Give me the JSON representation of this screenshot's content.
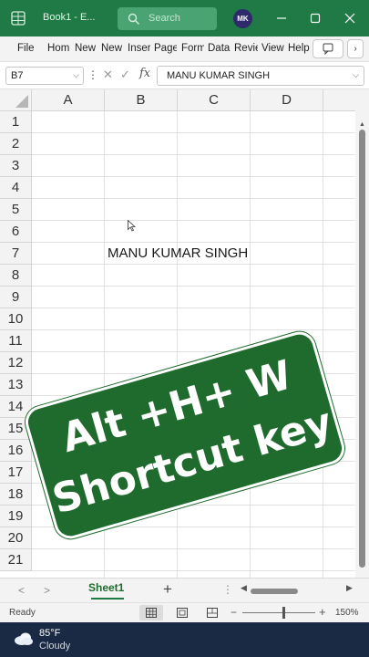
{
  "titlebar": {
    "doc_title": "Book1 - E...",
    "search_label": "Search",
    "avatar_initials": "MK"
  },
  "ribbon": {
    "tabs": [
      "File",
      "Hom",
      "New",
      "New",
      "Inser",
      "Page",
      "Form",
      "Data",
      "Revie",
      "View",
      "Help"
    ],
    "more": "›"
  },
  "formula_bar": {
    "name_box": "B7",
    "fx": "fx",
    "content": "MANU KUMAR SINGH"
  },
  "grid": {
    "columns": [
      "A",
      "B",
      "C",
      "D"
    ],
    "rows": [
      "1",
      "2",
      "3",
      "4",
      "5",
      "6",
      "7",
      "8",
      "9",
      "10",
      "11",
      "12",
      "13",
      "14",
      "15",
      "16",
      "17",
      "18",
      "19",
      "20",
      "21"
    ],
    "cell_b7": "MANU KUMAR SINGH"
  },
  "overlay": {
    "line1": "Alt +H+ W",
    "line2": "Shortcut key",
    "color": "#1f6b2d"
  },
  "sheet_bar": {
    "active_sheet": "Sheet1",
    "add": "+"
  },
  "status_bar": {
    "ready": "Ready",
    "zoom": "150%"
  },
  "taskbar": {
    "temperature": "85°F",
    "condition": "Cloudy"
  },
  "colors": {
    "excel_green": "#1f7a45",
    "taskbar": "#1b2a44"
  }
}
